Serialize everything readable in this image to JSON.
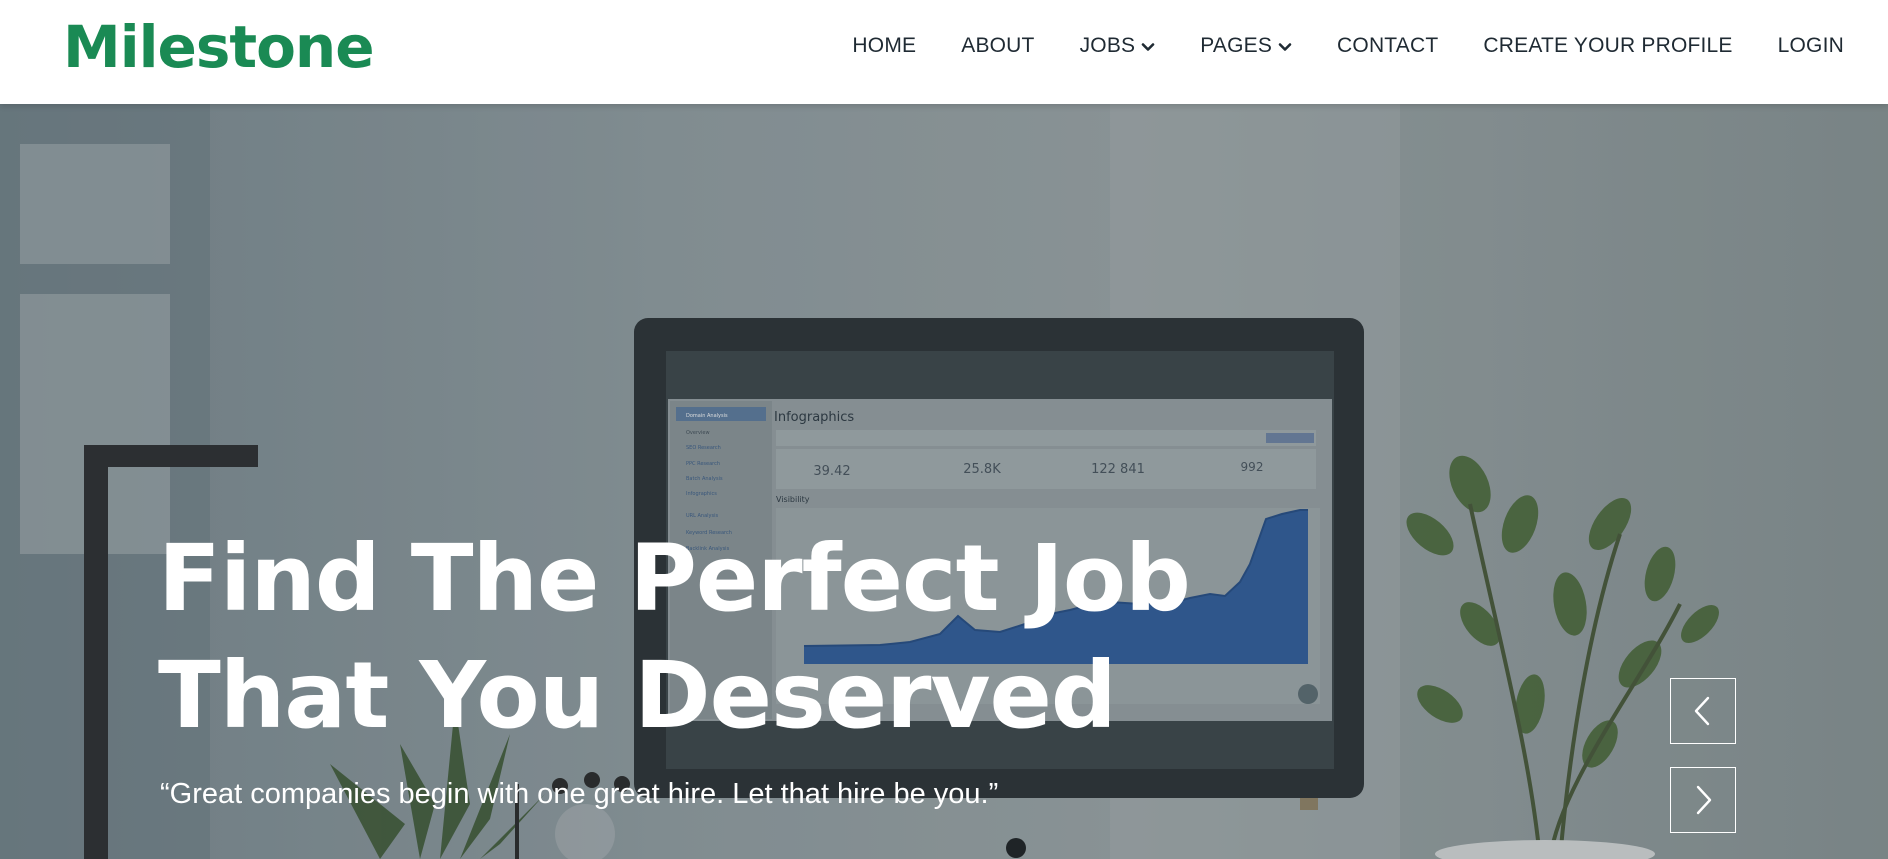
{
  "brand": {
    "name": "Milestone",
    "color": "#1a8a54"
  },
  "nav": {
    "items": [
      {
        "label": "HOME",
        "dropdown": false
      },
      {
        "label": "ABOUT",
        "dropdown": false
      },
      {
        "label": "JOBS",
        "dropdown": true
      },
      {
        "label": "PAGES",
        "dropdown": true
      },
      {
        "label": "CONTACT",
        "dropdown": false
      },
      {
        "label": "CREATE YOUR PROFILE",
        "dropdown": false
      },
      {
        "label": "LOGIN",
        "dropdown": false
      }
    ]
  },
  "hero": {
    "title_line1": "Find The Perfect Job",
    "title_line2": "That You Deserved",
    "quote": "“Great companies begin with one great hire. Let that hire be you.”",
    "prev_icon": "chevron-left-icon",
    "next_icon": "chevron-right-icon"
  },
  "screen": {
    "title": "Infographics",
    "stats": [
      "39.42",
      "25.8K",
      "122 841",
      "992"
    ],
    "section": "Visibility"
  }
}
